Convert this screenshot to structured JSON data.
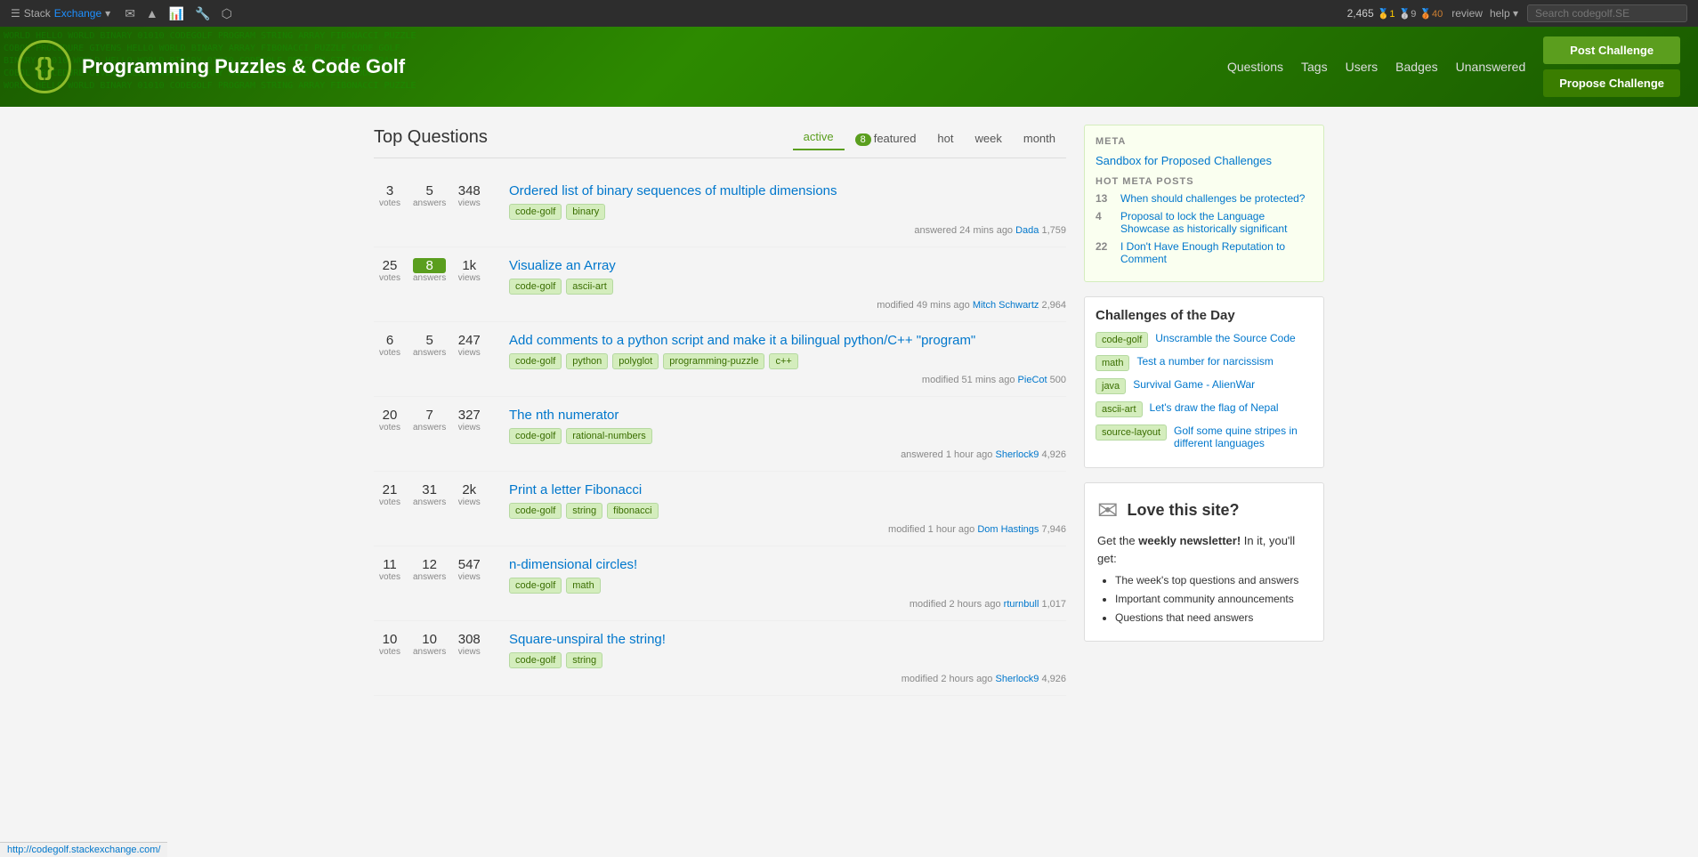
{
  "topbar": {
    "brand": "Stack",
    "exchange": "Exchange",
    "chevron": "▾",
    "icons": [
      "✉",
      "📊",
      "🔧",
      "🔗"
    ],
    "rep": "2,465",
    "badge_gold": "1",
    "badge_silver": "9",
    "badge_bronze": "40",
    "links": [
      "review",
      "help▾"
    ],
    "search_placeholder": "Search codegolf.SE"
  },
  "header": {
    "logo_symbol": "{}",
    "site_name": "Programming Puzzles & Code Golf",
    "nav": [
      "Questions",
      "Tags",
      "Users",
      "Badges",
      "Unanswered"
    ],
    "btn_post": "Post Challenge",
    "btn_propose": "Propose Challenge"
  },
  "questions": {
    "title": "Top Questions",
    "tabs": [
      {
        "label": "active",
        "active": true,
        "badge": null
      },
      {
        "label": "featured",
        "active": false,
        "badge": "8"
      },
      {
        "label": "hot",
        "active": false,
        "badge": null
      },
      {
        "label": "week",
        "active": false,
        "badge": null
      },
      {
        "label": "month",
        "active": false,
        "badge": null
      }
    ],
    "items": [
      {
        "votes": "3",
        "answers": "5",
        "views": "348",
        "answers_highlight": false,
        "title": "Ordered list of binary sequences of multiple dimensions",
        "tags": [
          "code-golf",
          "binary"
        ],
        "meta": "answered 24 mins ago",
        "user": "Dada",
        "user_rep": "1,759"
      },
      {
        "votes": "25",
        "answers": "8",
        "views": "1k",
        "answers_highlight": true,
        "title": "Visualize an Array",
        "tags": [
          "code-golf",
          "ascii-art"
        ],
        "meta": "modified 49 mins ago",
        "user": "Mitch Schwartz",
        "user_rep": "2,964"
      },
      {
        "votes": "6",
        "answers": "5",
        "views": "247",
        "answers_highlight": false,
        "title": "Add comments to a python script and make it a bilingual python/C++ \"program\"",
        "tags": [
          "code-golf",
          "python",
          "polyglot",
          "programming-puzzle",
          "c++"
        ],
        "meta": "modified 51 mins ago",
        "user": "PieCot",
        "user_rep": "500"
      },
      {
        "votes": "20",
        "answers": "7",
        "views": "327",
        "answers_highlight": false,
        "title": "The nth numerator",
        "tags": [
          "code-golf",
          "rational-numbers"
        ],
        "meta": "answered 1 hour ago",
        "user": "Sherlock9",
        "user_rep": "4,926"
      },
      {
        "votes": "21",
        "answers": "31",
        "views": "2k",
        "answers_highlight": false,
        "title": "Print a letter Fibonacci",
        "tags": [
          "code-golf",
          "string",
          "fibonacci"
        ],
        "meta": "modified 1 hour ago",
        "user": "Dom Hastings",
        "user_rep": "7,946"
      },
      {
        "votes": "11",
        "answers": "12",
        "views": "547",
        "answers_highlight": false,
        "title": "n-dimensional circles!",
        "tags": [
          "code-golf",
          "math"
        ],
        "meta": "modified 2 hours ago",
        "user": "rturnbull",
        "user_rep": "1,017"
      },
      {
        "votes": "10",
        "answers": "10",
        "views": "308",
        "answers_highlight": false,
        "title": "Square-unspiral the string!",
        "tags": [
          "code-golf",
          "string"
        ],
        "meta": "modified 2 hours ago",
        "user": "Sherlock9",
        "user_rep": "4,926"
      }
    ]
  },
  "sidebar": {
    "meta_title": "META",
    "sandbox_link": "Sandbox for Proposed Challenges",
    "hot_meta_title": "HOT META POSTS",
    "hot_meta": [
      {
        "num": "13",
        "text": "When should challenges be protected?"
      },
      {
        "num": "4",
        "text": "Proposal to lock the Language Showcase as historically significant"
      },
      {
        "num": "22",
        "text": "I Don't Have Enough Reputation to Comment"
      }
    ],
    "challenges_title": "Challenges of the Day",
    "challenges": [
      {
        "tag": "code-golf",
        "tag_class": "ctag-codegolf",
        "title": "Unscramble the Source Code"
      },
      {
        "tag": "math",
        "tag_class": "ctag-math",
        "title": "Test a number for narcissism"
      },
      {
        "tag": "java",
        "tag_class": "ctag-java",
        "title": "Survival Game - AlienWar"
      },
      {
        "tag": "ascii-art",
        "tag_class": "ctag-ascii",
        "title": "Let's draw the flag of Nepal"
      },
      {
        "tag": "source-layout",
        "tag_class": "ctag-source",
        "title": "Golf some quine stripes in different languages"
      }
    ],
    "newsletter_title": "Love this site?",
    "newsletter_sub": "Get the",
    "newsletter_bold": "weekly newsletter!",
    "newsletter_desc": "In it, you'll get:",
    "newsletter_items": [
      "The week's top questions and answers",
      "Important community announcements",
      "Questions that need answers"
    ]
  },
  "statusbar": {
    "url": "http://codegolf.stackexchange.com/"
  }
}
